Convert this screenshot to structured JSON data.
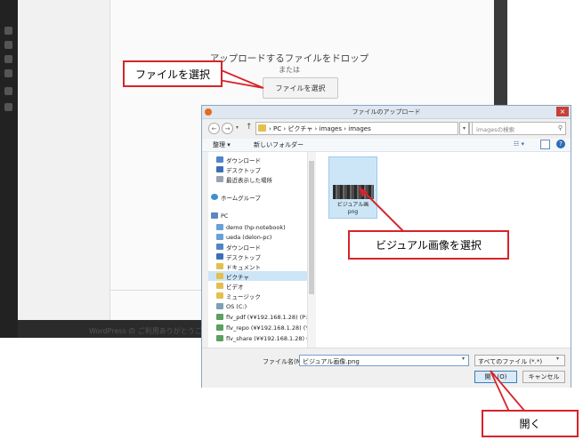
{
  "upload": {
    "title": "アップロードするファイルをドロップ",
    "or": "または",
    "select_button": "ファイルを選択"
  },
  "background_footer": "WordPress の ご利用ありがとうございます。",
  "callouts": {
    "select_file": "ファイルを選択",
    "select_visual": "ビジュアル画像を選択",
    "open": "開く"
  },
  "dialog": {
    "title": "ファイルのアップロード",
    "close": "×",
    "address": {
      "path": "›  PC  ›  ピクチャ  ›  images  ›  images",
      "back": "←",
      "forward": "→",
      "dropdown": "▾",
      "up": "↑",
      "refresh": "↻"
    },
    "search_placeholder": "imagesの検索",
    "toolbar": {
      "organize": "整理 ▾",
      "new_folder": "新しいフォルダー",
      "view": "☷ ▾",
      "help": "?"
    },
    "nav_items": [
      {
        "label": "ダウンロード",
        "icon": "download-folder-icon"
      },
      {
        "label": "デスクトップ",
        "icon": "desktop-icon"
      },
      {
        "label": "最近表示した場所",
        "icon": "recent-places-icon"
      },
      {
        "label": "ホームグループ",
        "icon": "homegroup-icon"
      },
      {
        "label": "PC",
        "icon": "pc-icon"
      },
      {
        "label": "demo (hp-notebook)",
        "icon": "user-icon"
      },
      {
        "label": "ueda (delon-pc)",
        "icon": "user-icon"
      },
      {
        "label": "ダウンロード",
        "icon": "download-folder-icon"
      },
      {
        "label": "デスクトップ",
        "icon": "desktop-icon"
      },
      {
        "label": "ドキュメント",
        "icon": "documents-folder-icon"
      },
      {
        "label": "ピクチャ",
        "icon": "pictures-folder-icon"
      },
      {
        "label": "ビデオ",
        "icon": "videos-folder-icon"
      },
      {
        "label": "ミュージック",
        "icon": "music-folder-icon"
      },
      {
        "label": "OS (C:)",
        "icon": "drive-icon"
      },
      {
        "label": "flv_pdf (¥¥192.168.1.28) (P:)",
        "icon": "network-drive-icon"
      },
      {
        "label": "flv_repo (¥¥192.168.1.28) (Y:)",
        "icon": "network-drive-icon"
      },
      {
        "label": "flv_share (¥¥192.168.1.28) (Z:",
        "icon": "network-drive-icon"
      }
    ],
    "file": {
      "name_line1": "ビジュアル画",
      "name_line2": "png"
    },
    "filename_label": "ファイル名(N):",
    "filename_value": "ビジュアル画像.png",
    "filetype_value": "すべてのファイル (*.*)",
    "open_button": "開く(O)",
    "cancel_button": "キャンセル"
  },
  "colors": {
    "callout_border": "#d8232a",
    "selection": "#cde6f7"
  }
}
